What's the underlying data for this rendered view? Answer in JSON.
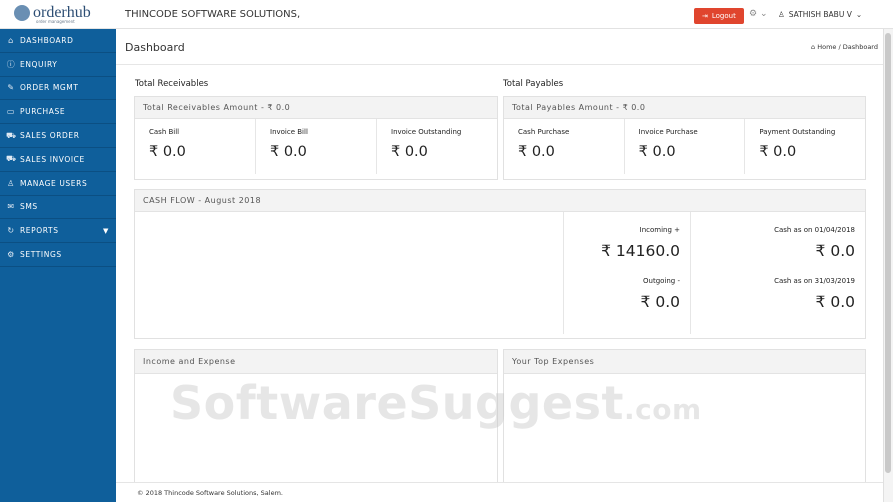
{
  "app": {
    "logo": {
      "brand": "orderhub",
      "tagline": "order management"
    },
    "company": "THINCODE SOFTWARE SOLUTIONS,",
    "logout_label": "Logout",
    "user_name": "SATHISH BABU V"
  },
  "sidebar": {
    "items": [
      {
        "label": "DASHBOARD",
        "icon": "home-icon"
      },
      {
        "label": "ENQUIRY",
        "icon": "info-icon"
      },
      {
        "label": "ORDER MGMT",
        "icon": "edit-icon"
      },
      {
        "label": "PURCHASE",
        "icon": "clipboard-icon"
      },
      {
        "label": "SALES ORDER",
        "icon": "cart-icon"
      },
      {
        "label": "SALES INVOICE",
        "icon": "cart-icon"
      },
      {
        "label": "MANAGE USERS",
        "icon": "user-icon"
      },
      {
        "label": "SMS",
        "icon": "mail-icon"
      },
      {
        "label": "REPORTS",
        "icon": "refresh-icon"
      },
      {
        "label": "SETTINGS",
        "icon": "gear-icon"
      }
    ]
  },
  "page": {
    "title": "Dashboard",
    "breadcrumb": "Home / Dashboard"
  },
  "receivables": {
    "section_title": "Total Receivables",
    "header": "Total Receivables Amount - ₹ 0.0",
    "cells": [
      {
        "label": "Cash Bill",
        "value": "₹ 0.0"
      },
      {
        "label": "Invoice Bill",
        "value": "₹ 0.0"
      },
      {
        "label": "Invoice Outstanding",
        "value": "₹ 0.0"
      }
    ]
  },
  "payables": {
    "section_title": "Total Payables",
    "header": "Total Payables Amount - ₹ 0.0",
    "cells": [
      {
        "label": "Cash Purchase",
        "value": "₹ 0.0"
      },
      {
        "label": "Invoice Purchase",
        "value": "₹ 0.0"
      },
      {
        "label": "Payment Outstanding",
        "value": "₹ 0.0"
      }
    ]
  },
  "cashflow": {
    "header": "CASH FLOW - August 2018",
    "incoming_label": "Incoming +",
    "incoming_value": "₹ 14160.0",
    "outgoing_label": "Outgoing -",
    "outgoing_value": "₹ 0.0",
    "cash_start_label": "Cash as on 01/04/2018",
    "cash_start_value": "₹ 0.0",
    "cash_end_label": "Cash as on 31/03/2019",
    "cash_end_value": "₹ 0.0"
  },
  "income_expense": {
    "header": "Income and Expense"
  },
  "top_expenses": {
    "header": "Your Top Expenses"
  },
  "watermark": {
    "main": "SoftwareSuggest",
    "suffix": ".com"
  },
  "footer": {
    "text": "© 2018 Thincode Software Solutions, Salem."
  },
  "colors": {
    "sidebar": "#0f5f9b",
    "logout": "#e0452e"
  }
}
